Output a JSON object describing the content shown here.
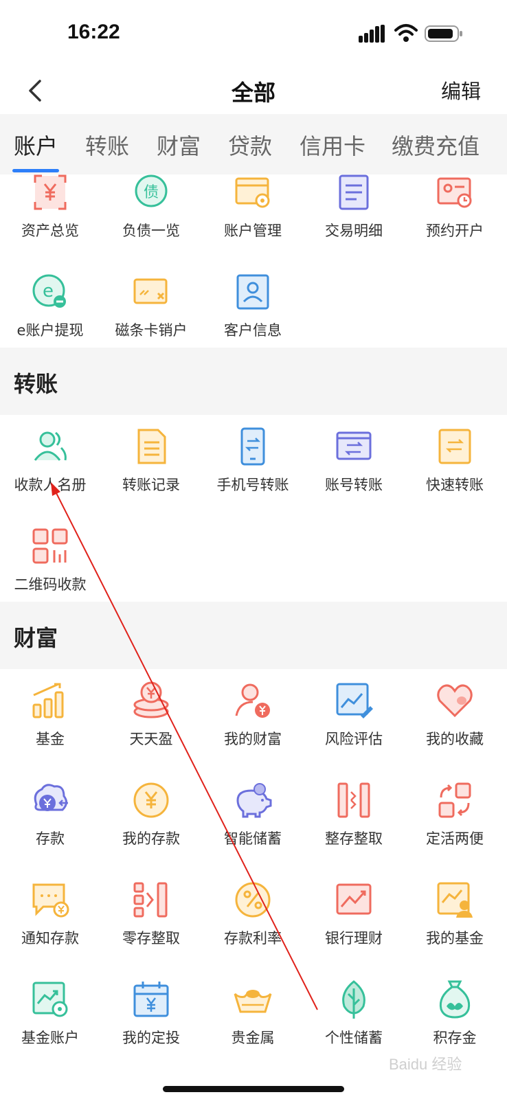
{
  "status_bar": {
    "time": "16:22"
  },
  "nav": {
    "title": "全部",
    "edit_label": "编辑"
  },
  "tabs": [
    {
      "label": "账户",
      "active": true
    },
    {
      "label": "转账"
    },
    {
      "label": "财富"
    },
    {
      "label": "贷款"
    },
    {
      "label": "信用卡"
    },
    {
      "label": "缴费充值"
    }
  ],
  "account_items": [
    {
      "label": "资产总览",
      "icon": "asset-overview-icon"
    },
    {
      "label": "负债一览",
      "icon": "debt-icon"
    },
    {
      "label": "账户管理",
      "icon": "account-manage-icon"
    },
    {
      "label": "交易明细",
      "icon": "transaction-detail-icon"
    },
    {
      "label": "预约开户",
      "icon": "appointment-account-icon"
    },
    {
      "label": "e账户提现",
      "icon": "e-account-withdraw-icon"
    },
    {
      "label": "磁条卡销户",
      "icon": "magnetic-card-close-icon"
    },
    {
      "label": "客户信息",
      "icon": "customer-info-icon"
    }
  ],
  "transfer_section": {
    "title": "转账",
    "items": [
      {
        "label": "收款人名册",
        "icon": "payee-list-icon"
      },
      {
        "label": "转账记录",
        "icon": "transfer-record-icon"
      },
      {
        "label": "手机号转账",
        "icon": "phone-transfer-icon"
      },
      {
        "label": "账号转账",
        "icon": "account-transfer-icon"
      },
      {
        "label": "快速转账",
        "icon": "quick-transfer-icon"
      },
      {
        "label": "二维码收款",
        "icon": "qr-code-icon"
      }
    ]
  },
  "wealth_section": {
    "title": "财富",
    "items": [
      {
        "label": "基金",
        "icon": "fund-icon"
      },
      {
        "label": "天天盈",
        "icon": "coins-icon"
      },
      {
        "label": "我的财富",
        "icon": "my-wealth-icon"
      },
      {
        "label": "风险评估",
        "icon": "risk-assessment-icon"
      },
      {
        "label": "我的收藏",
        "icon": "heart-icon"
      },
      {
        "label": "存款",
        "icon": "deposit-icon"
      },
      {
        "label": "我的存款",
        "icon": "my-deposit-icon"
      },
      {
        "label": "智能储蓄",
        "icon": "piggy-bank-icon"
      },
      {
        "label": "整存整取",
        "icon": "lump-sum-icon"
      },
      {
        "label": "定活两便",
        "icon": "flexible-deposit-icon"
      },
      {
        "label": "通知存款",
        "icon": "notice-deposit-icon"
      },
      {
        "label": "零存整取",
        "icon": "installment-deposit-icon"
      },
      {
        "label": "存款利率",
        "icon": "percent-icon"
      },
      {
        "label": "银行理财",
        "icon": "bank-finance-icon"
      },
      {
        "label": "我的基金",
        "icon": "my-fund-icon"
      },
      {
        "label": "基金账户",
        "icon": "fund-account-icon"
      },
      {
        "label": "我的定投",
        "icon": "calendar-icon"
      },
      {
        "label": "贵金属",
        "icon": "gold-ingot-icon"
      },
      {
        "label": "个性储蓄",
        "icon": "leaf-icon"
      },
      {
        "label": "积存金",
        "icon": "money-bag-icon"
      }
    ]
  },
  "watermark": "Baidu 经验"
}
